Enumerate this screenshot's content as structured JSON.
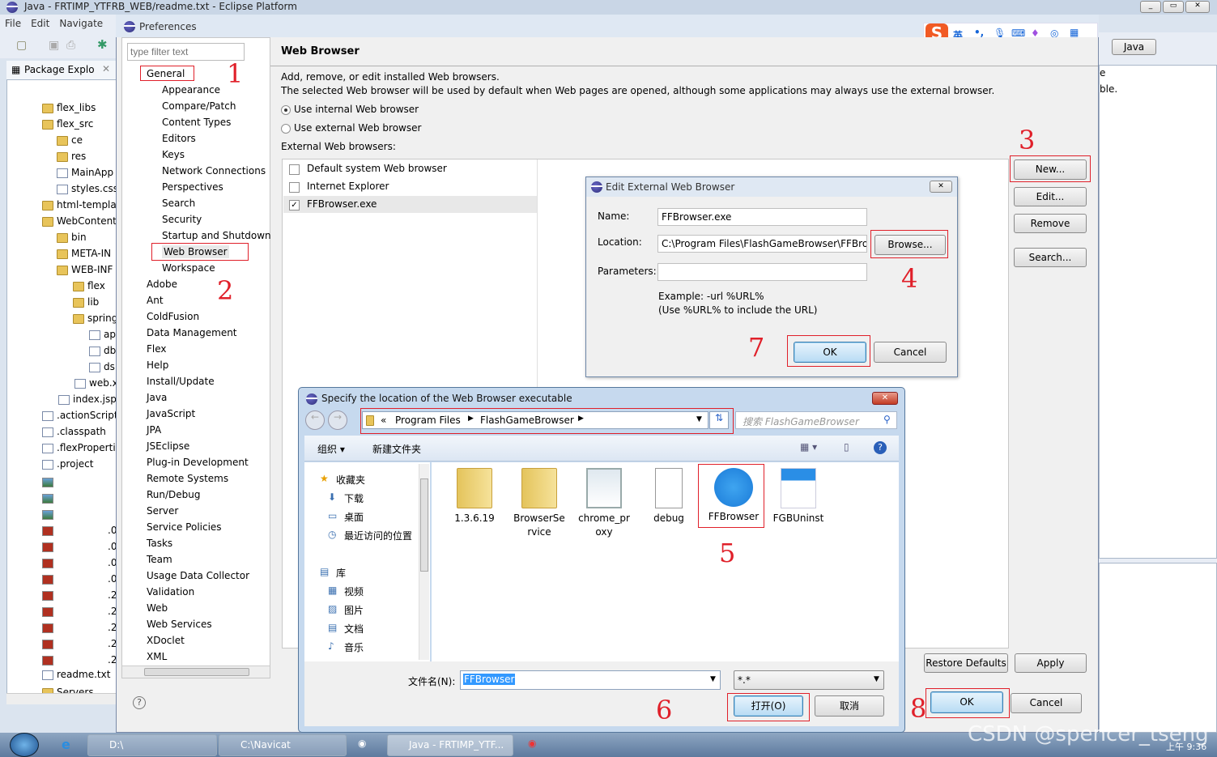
{
  "window": {
    "title": "Java - FRTIMP_YTFRB_WEB/readme.txt - Eclipse Platform",
    "menu": [
      "File",
      "Edit",
      "Navigate"
    ]
  },
  "package_explorer": {
    "tab": "Package Explo",
    "items": [
      "flex_libs",
      "flex_src",
      "ce",
      "res",
      "MainApp",
      "styles.css",
      "html-templa",
      "WebContent",
      "bin",
      "META-IN",
      "WEB-INF",
      "flex",
      "lib",
      "spring",
      "ap",
      "db",
      "ds",
      "web.x",
      "index.jsp",
      ".actionScript",
      ".classpath",
      ".flexProperti",
      ".project",
      "readme.txt",
      "Servers"
    ],
    "truncated_suffixes": [
      ".0",
      ".0",
      ".0",
      ".0",
      ".2",
      ".2",
      ".2",
      ".2",
      ".2"
    ]
  },
  "right_pane": {
    "perspective": "Java",
    "text_fragment": "ble.",
    "tab_fragment": "e"
  },
  "ime_bar": {
    "lang": "英",
    "punct": "•,"
  },
  "preferences": {
    "title": "Preferences",
    "filter_placeholder": "type filter text",
    "tree_general": "General",
    "tree_general_children": [
      "Appearance",
      "Compare/Patch",
      "Content Types",
      "Editors",
      "Keys",
      "Network Connections",
      "Perspectives",
      "Search",
      "Security",
      "Startup and Shutdown",
      "Web Browser",
      "Workspace"
    ],
    "tree_top": [
      "Adobe",
      "Ant",
      "ColdFusion",
      "Data Management",
      "Flex",
      "Help",
      "Install/Update",
      "Java",
      "JavaScript",
      "JPA",
      "JSEclipse",
      "Plug-in Development",
      "Remote Systems",
      "Run/Debug",
      "Server",
      "Service Policies",
      "Tasks",
      "Team",
      "Usage Data Collector",
      "Validation",
      "Web",
      "Web Services",
      "XDoclet",
      "XML"
    ],
    "page_title": "Web Browser",
    "desc1": "Add, remove, or edit installed Web browsers.",
    "desc2": "The selected Web browser will be used by default when Web pages are opened, although some applications may always use the external browser.",
    "radio_internal": "Use internal Web browser",
    "radio_external": "Use external Web browser",
    "external_label": "External Web browsers:",
    "browsers": [
      {
        "name": "Default system Web browser",
        "checked": false
      },
      {
        "name": "Internet Explorer",
        "checked": false
      },
      {
        "name": "FFBrowser.exe",
        "checked": true
      }
    ],
    "buttons": {
      "new": "New...",
      "edit": "Edit...",
      "remove": "Remove",
      "search": "Search...",
      "restore": "Restore Defaults",
      "apply": "Apply",
      "ok": "OK",
      "cancel": "Cancel"
    },
    "help": "?"
  },
  "edit_dialog": {
    "title": "Edit External Web Browser",
    "name_label": "Name:",
    "name_value": "FFBrowser.exe",
    "location_label": "Location:",
    "location_value": "C:\\Program Files\\FlashGameBrowser\\FFBrow",
    "browse": "Browse...",
    "params_label": "Parameters:",
    "params_value": "",
    "example1": "Example: -url %URL%",
    "example2": "(Use %URL% to include the URL)",
    "ok": "OK",
    "cancel": "Cancel"
  },
  "file_dialog": {
    "title": "Specify the location of the Web Browser executable",
    "path": [
      "«",
      "Program Files",
      "FlashGameBrowser"
    ],
    "search_placeholder": "搜索 FlashGameBrowser",
    "organize": "组织 ▾",
    "new_folder": "新建文件夹",
    "sidebar": [
      {
        "label": "收藏夹",
        "indent": 0
      },
      {
        "label": "下载",
        "indent": 1
      },
      {
        "label": "桌面",
        "indent": 1
      },
      {
        "label": "最近访问的位置",
        "indent": 1
      },
      {
        "label": "库",
        "indent": 0
      },
      {
        "label": "视频",
        "indent": 1
      },
      {
        "label": "图片",
        "indent": 1
      },
      {
        "label": "文档",
        "indent": 1
      },
      {
        "label": "音乐",
        "indent": 1
      }
    ],
    "files": [
      {
        "name": "1.3.6.19",
        "type": "folder"
      },
      {
        "name": "BrowserSe rvice",
        "type": "folder"
      },
      {
        "name": "chrome_pr oxy",
        "type": "app"
      },
      {
        "name": "debug",
        "type": "text"
      },
      {
        "name": "FFBrowser",
        "type": "ffbrowser"
      },
      {
        "name": "FGBUninst",
        "type": "uninst"
      }
    ],
    "filename_label": "文件名(N):",
    "filename_value": "FFBrowser",
    "filter_value": "*.*",
    "open": "打开(O)",
    "cancel": "取消"
  },
  "annotations": [
    "1",
    "2",
    "3",
    "4",
    "5",
    "6",
    "7",
    "8"
  ],
  "taskbar": {
    "items": [
      "D:\\",
      "C:\\Navicat",
      "Java - FRTIMP_YTF..."
    ],
    "clock": "上午 9:36",
    "watermark": "CSDN @spencer_tseng"
  },
  "colors": {
    "annotation": "#e0202a",
    "selection": "#3399ff"
  }
}
